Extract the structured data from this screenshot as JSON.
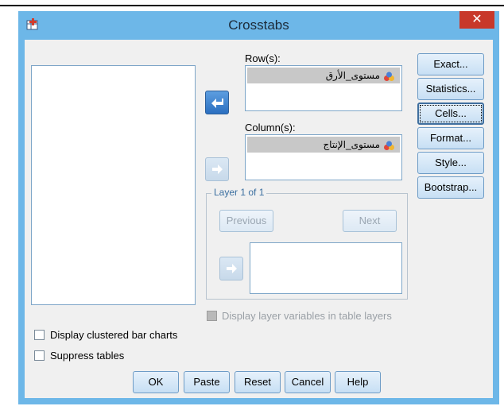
{
  "window": {
    "title": "Crosstabs",
    "close_glyph": "✕"
  },
  "rows_label": "Row(s):",
  "rows_item": "مستوى_الأرق",
  "columns_label": "Column(s):",
  "columns_item": "مستوى_الإنتاج",
  "layer": {
    "title": "Layer 1 of 1",
    "previous": "Previous",
    "next": "Next"
  },
  "side_buttons": {
    "exact": "Exact...",
    "statistics": "Statistics...",
    "cells": "Cells...",
    "format": "Format...",
    "style": "Style...",
    "bootstrap": "Bootstrap..."
  },
  "display_layer_label": "Display layer variables in table layers",
  "clustered_bar_label": "Display clustered bar charts",
  "suppress_tables_label": "Suppress tables",
  "bottom_buttons": {
    "ok": "OK",
    "paste": "Paste",
    "reset": "Reset",
    "cancel": "Cancel",
    "help": "Help"
  },
  "icons": {
    "variable": "nominal-variable-icon",
    "move_left": "arrow-left-icon",
    "move_right": "arrow-right-icon"
  }
}
